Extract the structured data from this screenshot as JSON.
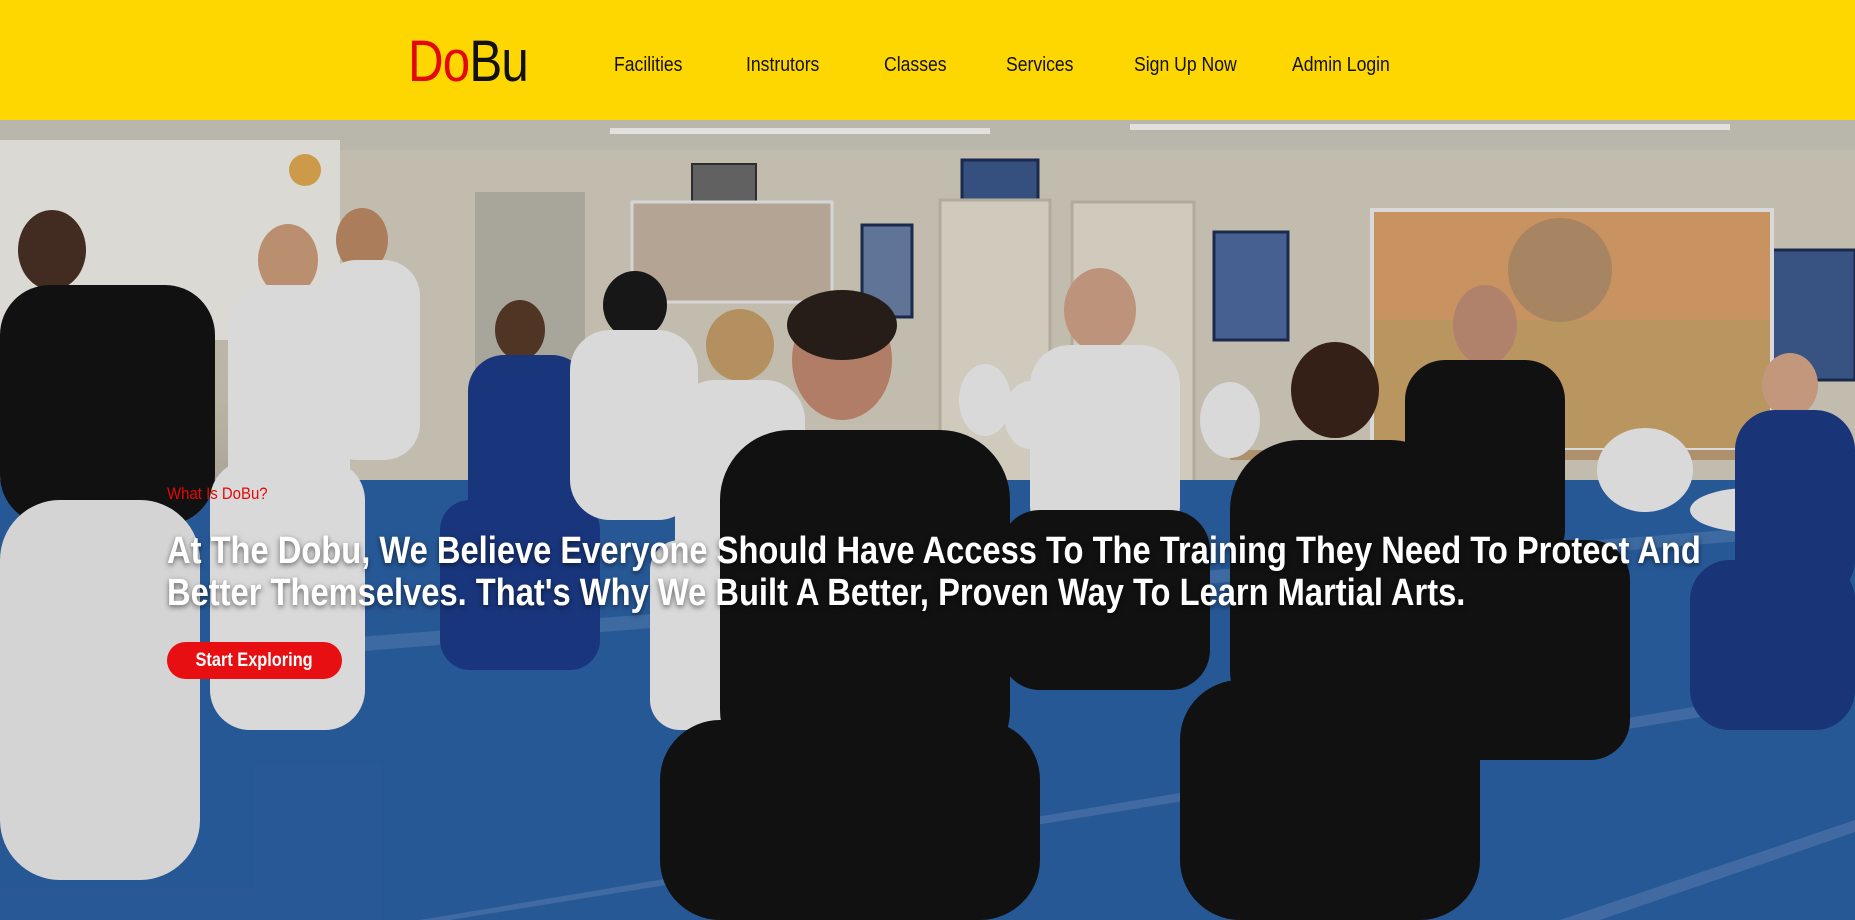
{
  "logo": {
    "part1": "Do",
    "part2": "Bu"
  },
  "nav": {
    "items": [
      {
        "label": "Facilities"
      },
      {
        "label": "Instrutors"
      },
      {
        "label": "Classes"
      },
      {
        "label": "Services"
      },
      {
        "label": "Sign Up Now"
      },
      {
        "label": "Admin Login"
      }
    ]
  },
  "hero": {
    "eyebrow": "What Is DoBu?",
    "headline_line1": "At The Dobu, We Believe Everyone Should Have Access To The Training They Need To Protect And",
    "headline_line2": "Better Themselves. That's Why We Built A Better, Proven Way To Learn Martial Arts.",
    "cta_label": "Start Exploring",
    "background_description": "photo-martial-arts-class"
  },
  "colors": {
    "header_bg": "#FFD700",
    "logo_red": "#E4080A",
    "logo_black": "#111111",
    "eyebrow_red": "#E4080A",
    "cta_bg": "#E80F12",
    "mat_blue": "#2d63a8"
  }
}
